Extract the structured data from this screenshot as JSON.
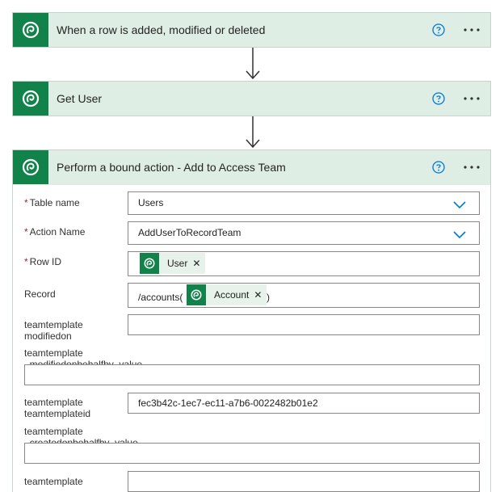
{
  "steps": [
    {
      "title": "When a row is added, modified or deleted"
    },
    {
      "title": "Get User"
    },
    {
      "title": "Perform a bound action - Add to Access Team"
    }
  ],
  "form": {
    "table_name": {
      "label": "Table name",
      "required": true,
      "value": "Users"
    },
    "action_name": {
      "label": "Action Name",
      "required": true,
      "value": "AddUserToRecordTeam"
    },
    "row_id": {
      "label": "Row ID",
      "required": true,
      "token": "User"
    },
    "record": {
      "label": "Record",
      "prefix": "/accounts(",
      "token": "Account",
      "suffix": ")"
    },
    "tt_modifiedon": {
      "label_1": "teamtemplate",
      "label_2": "modifiedon",
      "value": ""
    },
    "tt_modifiedonbehalfby": {
      "label_1": "teamtemplate",
      "label_2": "_modifiedonbehalfby_value",
      "value": ""
    },
    "tt_teamtemplateid": {
      "label_1": "teamtemplate",
      "label_2": "teamtemplateid",
      "value": "fec3b42c-1ec7-ec11-a7b6-0022482b01e2"
    },
    "tt_createdonbehalfby": {
      "label_1": "teamtemplate",
      "label_2": "_createdonbehalfby_value",
      "value": ""
    },
    "tt_last": {
      "label_1": "teamtemplate",
      "value": ""
    }
  },
  "colors": {
    "brand": "#10824a",
    "header_bg": "#deeee5",
    "accent_blue": "#0078d4",
    "required": "#a4262c"
  },
  "icons": {
    "connector": "dataverse-logo-icon",
    "help": "help-circle-icon",
    "more": "more-ellipsis-icon",
    "dropdown": "chevron-down-icon",
    "remove": "close-icon"
  }
}
